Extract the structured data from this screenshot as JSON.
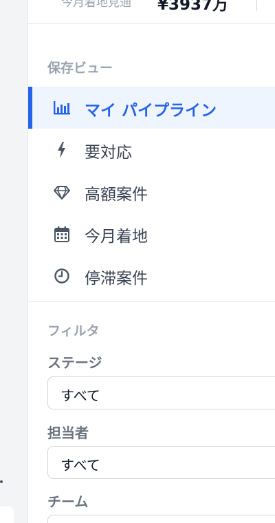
{
  "summary": {
    "label": "今月着地見通",
    "value": "¥3937万"
  },
  "saved_views": {
    "title": "保存ビュー",
    "items": [
      {
        "label": "マイ パイプライン",
        "icon": "bar-chart-icon",
        "active": true
      },
      {
        "label": "要対応",
        "icon": "bolt-icon",
        "active": false
      },
      {
        "label": "高額案件",
        "icon": "diamond-icon",
        "active": false
      },
      {
        "label": "今月着地",
        "icon": "calendar-icon",
        "active": false
      },
      {
        "label": "停滞案件",
        "icon": "clock-icon",
        "active": false
      }
    ]
  },
  "filters": {
    "title": "フィルタ",
    "stage": {
      "label": "ステージ",
      "value": "すべて"
    },
    "owner": {
      "label": "担当者",
      "value": "すべて"
    },
    "team": {
      "label": "チーム",
      "value": ""
    }
  },
  "colors": {
    "accent": "#2563eb",
    "active_bg": "#eff5ff"
  }
}
